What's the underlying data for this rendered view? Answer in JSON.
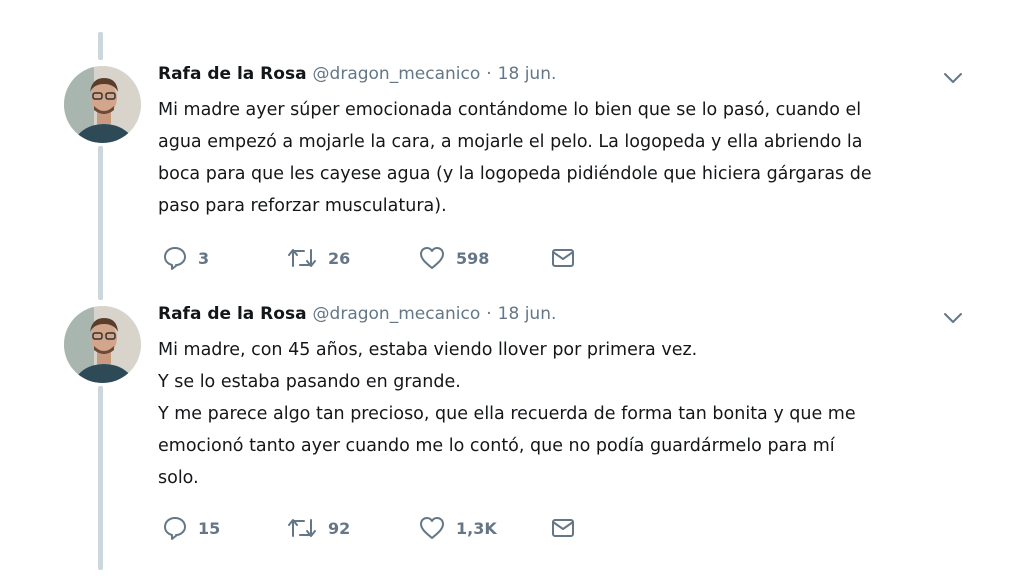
{
  "tweets": [
    {
      "name": "Rafa de la Rosa",
      "handle": "@dragon_mecanico",
      "separator": "·",
      "date": "18 jun.",
      "lines": [
        "Mi madre ayer súper emocionada contándome lo bien que se lo pasó, cuando el",
        "agua empezó a mojarle la cara, a mojarle el pelo. La logopeda y ella abriendo la",
        "boca para que les cayese agua (y la logopeda pidiéndole que hiciera gárgaras de",
        "paso para reforzar musculatura)."
      ],
      "replies": "3",
      "retweets": "26",
      "likes": "598"
    },
    {
      "name": "Rafa de la Rosa",
      "handle": "@dragon_mecanico",
      "separator": "·",
      "date": "18 jun.",
      "lines": [
        "Mi madre, con 45 años, estaba viendo llover por primera vez.",
        "Y se lo estaba pasando en grande.",
        "Y me parece algo tan precioso, que ella recuerda de forma tan bonita y que me",
        "emocionó tanto ayer cuando me lo contó, que no podía guardármelo para mí",
        "solo."
      ],
      "replies": "15",
      "retweets": "92",
      "likes": "1,3K"
    }
  ],
  "icons": {
    "reply": "reply-icon",
    "retweet": "retweet-icon",
    "like": "heart-icon",
    "message": "envelope-icon",
    "more": "chevron-down-icon"
  },
  "colors": {
    "text": "#14171a",
    "muted": "#657786",
    "thread_line": "#ccd6dd",
    "background": "#ffffff"
  }
}
